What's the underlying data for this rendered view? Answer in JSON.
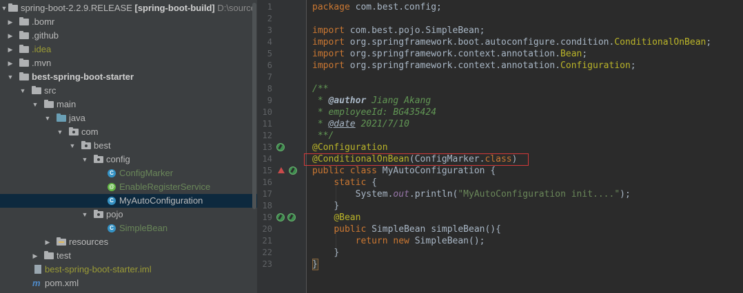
{
  "tree": {
    "root": {
      "name": "spring-boot-2.2.9.RELEASE",
      "module": "[spring-boot-build]",
      "path": "D:\\source"
    },
    "items": [
      {
        "label": ".bomr"
      },
      {
        "label": ".github"
      },
      {
        "label": ".idea"
      },
      {
        "label": ".mvn"
      },
      {
        "label": "best-spring-boot-starter"
      },
      {
        "label": "src"
      },
      {
        "label": "main"
      },
      {
        "label": "java"
      },
      {
        "label": "com"
      },
      {
        "label": "best"
      },
      {
        "label": "config"
      },
      {
        "label": "ConfigMarker"
      },
      {
        "label": "EnableRegisterService"
      },
      {
        "label": "MyAutoConfiguration"
      },
      {
        "label": "pojo"
      },
      {
        "label": "SimpleBean"
      },
      {
        "label": "resources"
      },
      {
        "label": "test"
      },
      {
        "label": "best-spring-boot-starter.iml"
      },
      {
        "label": "pom.xml"
      }
    ],
    "selected": "MyAutoConfiguration",
    "colors": {
      "background": "#3C3F41",
      "selection": "#0D293E"
    }
  },
  "editor": {
    "line_numbers": [
      "1",
      "2",
      "3",
      "4",
      "5",
      "6",
      "7",
      "8",
      "9",
      "10",
      "11",
      "12",
      "13",
      "14",
      "15",
      "16",
      "17",
      "18",
      "19",
      "20",
      "21",
      "22",
      "23"
    ],
    "tokens": {
      "package": "package",
      "package_name": "com.best.config;",
      "import": "import",
      "imp1": "com.best.pojo.SimpleBean;",
      "imp2a": "org.springframework.boot.autoconfigure.condition.",
      "imp2b": "ConditionalOnBean",
      "imp2c": ";",
      "imp3a": "org.springframework.context.annotation.",
      "imp3b": "Bean",
      "imp3c": ";",
      "imp4a": "org.springframework.context.annotation.",
      "imp4b": "Configuration",
      "imp4c": ";",
      "doc_open": "/**",
      "author_tag": "@author",
      "author_val": "Jiang Akang",
      "emp_line": "employeeId: BG435424",
      "date_tag": "@date",
      "date_val": "2021/7/10",
      "doc_close": "**/",
      "anno_config": "@Configuration",
      "anno_cond": "@ConditionalOnBean",
      "cond_open": "(",
      "cond_arg": "ConfigMarker",
      "cond_dot": ".",
      "cond_class": "class",
      "cond_close": ")",
      "public": "public",
      "class": "class",
      "class_name": "MyAutoConfiguration",
      "brace_open": "{",
      "static": "static",
      "system": "System.",
      "out": "out",
      "println": ".println(",
      "init_str": "\"MyAutoConfiguration init....\"",
      "println_end": ");",
      "brace_close": "}",
      "anno_bean": "@Bean",
      "bean_type": "SimpleBean",
      "bean_method": "simpleBean(){",
      "return": "return",
      "new": "new",
      "bean_new": "SimpleBean();",
      "star": "*"
    },
    "gutter_icons": [
      "bean-icon",
      "bean-override-icon",
      "bean-icon",
      "bean-navigate-icon"
    ],
    "highlight_color": "#D53A3A"
  }
}
